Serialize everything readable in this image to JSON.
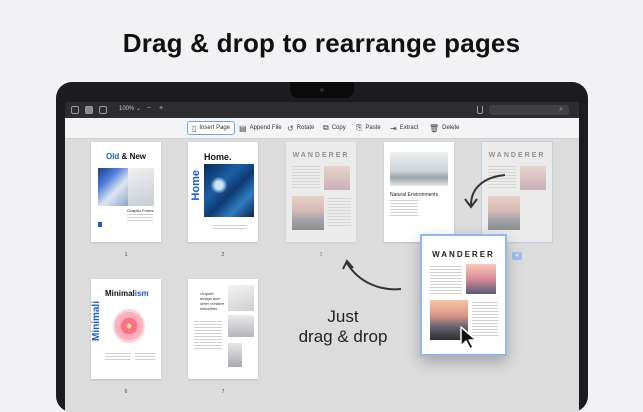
{
  "headline": "Drag & drop to rearrange pages",
  "menubar": {
    "zoom": "100%",
    "zoom_minus": "−",
    "zoom_plus": "+"
  },
  "toolbar": {
    "insert_page": "Insert Page",
    "append_file": "Append File",
    "rotate": "Rotate",
    "copy": "Copy",
    "paste": "Paste",
    "extract": "Extract",
    "delete": "Delete"
  },
  "pages": {
    "p1": {
      "title_a": "Old",
      "title_amp": "&",
      "title_b": "New",
      "caption": "Graphic Forms",
      "num": "1"
    },
    "p2": {
      "title": "Home.",
      "vertical": "Home",
      "num": "2"
    },
    "p3": {
      "title": "WANDERER",
      "num": "3"
    },
    "p4": {
      "caption": "Natural Environments"
    },
    "p5": {
      "title": "WANDERER",
      "num": "4"
    },
    "p6": {
      "title_a": "Minimal",
      "title_b": "ism",
      "vertical": "Minimali",
      "num": "6"
    },
    "p7": {
      "caption": "Graphic design and other creative industries",
      "num": "7"
    }
  },
  "drag_card": {
    "title": "WANDERER"
  },
  "callout": {
    "line1": "Just",
    "line2": "drag & drop"
  },
  "colors": {
    "accent": "#1a5ad8",
    "selection": "#8fb8ec"
  }
}
